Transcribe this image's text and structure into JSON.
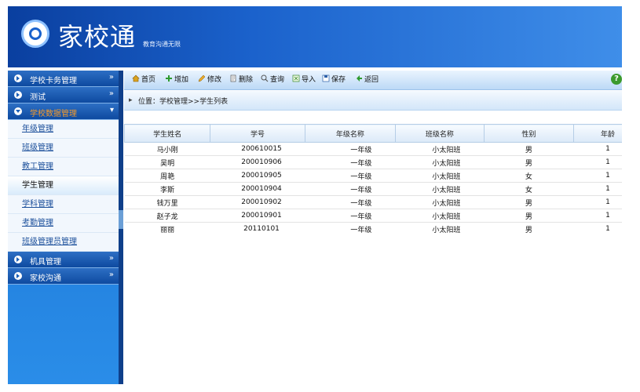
{
  "header": {
    "title": "家校通",
    "slogan": "教育沟通无限"
  },
  "sidebar": {
    "groups": [
      {
        "label": "学校卡务管理",
        "arrow": "»"
      },
      {
        "label": "测试",
        "arrow": "»"
      },
      {
        "label": "学校数据管理",
        "arrow": "▾"
      },
      {
        "label": "机具管理",
        "arrow": "»"
      },
      {
        "label": "家校沟通",
        "arrow": "»"
      }
    ],
    "sub_items": [
      "年级管理",
      "班级管理",
      "教工管理",
      "学生管理",
      "学科管理",
      "考勤管理",
      "班级管理员管理"
    ]
  },
  "toolbar": {
    "home": "首页",
    "add": "增加",
    "edit": "修改",
    "delete": "删除",
    "query": "查询",
    "import": "导入",
    "save": "保存",
    "back": "返回",
    "help": "?"
  },
  "location": {
    "text": "位置：学校管理>>学生列表"
  },
  "table": {
    "headers": [
      "学生姓名",
      "学号",
      "年级名称",
      "班级名称",
      "性别",
      "年龄"
    ],
    "rows": [
      [
        "马小刚",
        "200610015",
        "一年级",
        "小太阳班",
        "男",
        "1"
      ],
      [
        "吴明",
        "200010906",
        "一年级",
        "小太阳班",
        "男",
        "1"
      ],
      [
        "周艳",
        "200010905",
        "一年级",
        "小太阳班",
        "女",
        "1"
      ],
      [
        "李斯",
        "200010904",
        "一年级",
        "小太阳班",
        "女",
        "1"
      ],
      [
        "钱万里",
        "200010902",
        "一年级",
        "小太阳班",
        "男",
        "1"
      ],
      [
        "赵子龙",
        "200010901",
        "一年级",
        "小太阳班",
        "男",
        "1"
      ],
      [
        "丽丽",
        "20110101",
        "一年级",
        "小太阳班",
        "男",
        "1"
      ]
    ]
  }
}
